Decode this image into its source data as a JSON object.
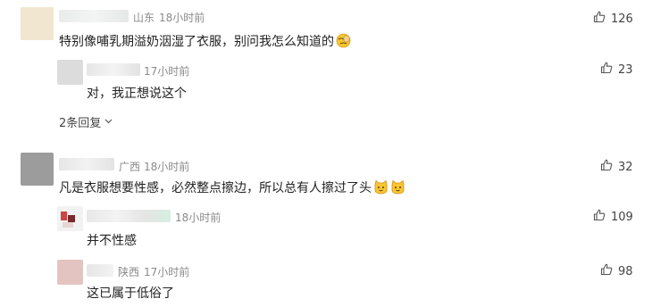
{
  "comments": [
    {
      "location": "山东",
      "time": "18小时前",
      "text": "特别像哺乳期溢奶洇湿了衣服，别问我怎么知道的",
      "likes": "126",
      "replies": [
        {
          "text": "对，我正想说这个",
          "time": "17小时前",
          "likes": "23"
        }
      ],
      "more_replies": "2条回复"
    },
    {
      "location": "广西",
      "time": "18小时前",
      "text": "凡是衣服想要性感，必然整点擦边，所以总有人擦过了头",
      "likes": "32",
      "replies": [
        {
          "text": "并不性感",
          "time": "18小时前",
          "likes": "109"
        },
        {
          "location": "陕西",
          "text": "这已属于低俗了",
          "time": "17小时前",
          "likes": "98"
        }
      ]
    }
  ],
  "icons": {
    "like": "thumbs-up-icon",
    "chevron": "chevron-down-icon",
    "emoji_facepalm": "facepalm-emoji-icon",
    "emoji_cat": "cat-emoji-icon"
  }
}
